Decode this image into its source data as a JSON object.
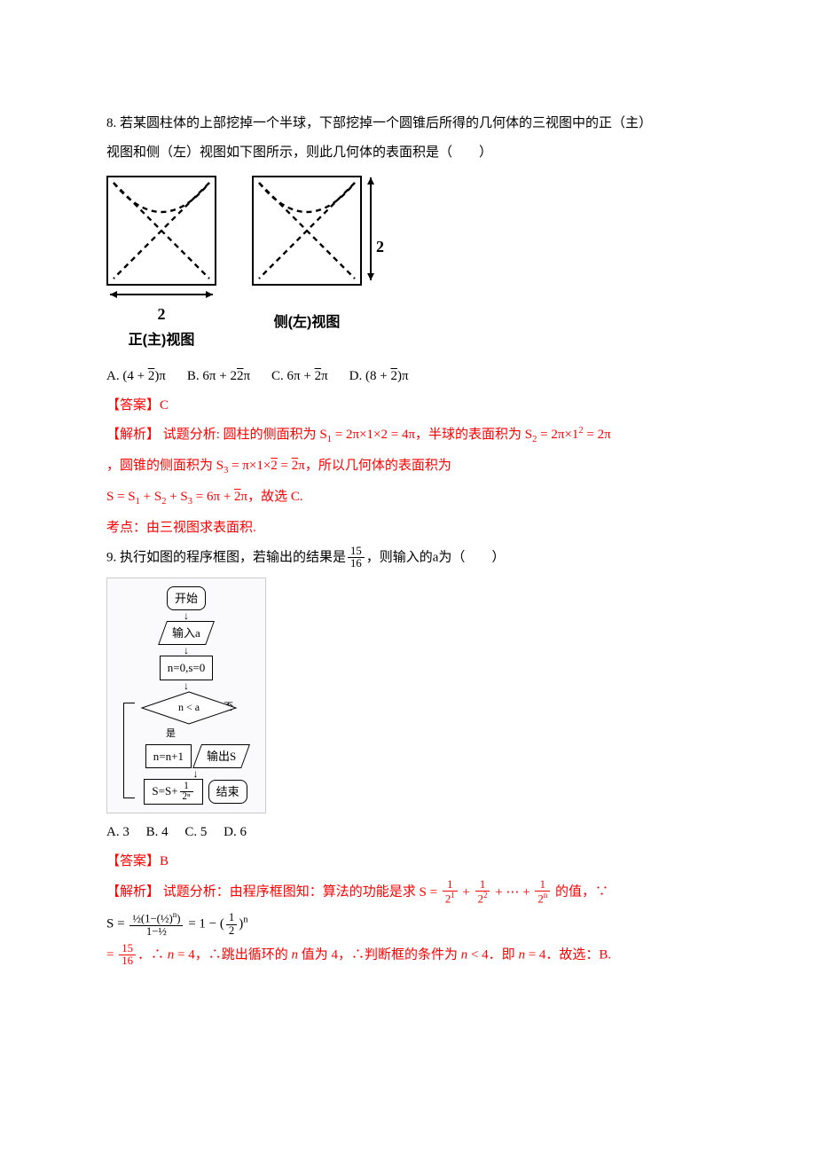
{
  "q8": {
    "number": "8.",
    "text_line1": "若某圆柱体的上部挖掉一个半球，下部挖掉一个圆锥后所得的几何体的三视图中的正（主）",
    "text_line2": "视图和侧（左）视图如下图所示，则此几何体的表面积是（　　）",
    "figure": {
      "front_label": "正(主)视图",
      "side_label": "侧(左)视图",
      "width": "2",
      "height": "2"
    },
    "choices": {
      "A_label": "A.",
      "A": "(4 + √2)π",
      "B_label": "B.",
      "B": "6π + 2√2π",
      "C_label": "C.",
      "C": "6π + √2π",
      "D_label": "D.",
      "D": "(8 + √2)π"
    },
    "answer_label": "【答案】",
    "answer": "C",
    "analysis_label": "【解析】",
    "analysis_1": "试题分析: 圆柱的侧面积为 S₁ = 2π×1×2 = 4π，半球的表面积为 S₂ = 2π×1² = 2π",
    "analysis_2": "，圆锥的侧面积为 S₃ = π×1×√2 = √2π，所以几何体的表面积为",
    "analysis_3": "S = S₁ + S₂ + S₃ = 6π + √2π，故选 C.",
    "topic": "考点：由三视图求表面积."
  },
  "q9": {
    "number": "9.",
    "text": "执行如图的程序框图，若输出的结果是",
    "frac": "15/16",
    "text2": "，则输入的a为（　　）",
    "flowchart": {
      "start": "开始",
      "input": "输入a",
      "init": "n=0,s=0",
      "cond": "n < a",
      "yes": "是",
      "no": "否",
      "step1": "n=n+1",
      "step2_prefix": "S=S+",
      "step2_frac_num": "1",
      "step2_frac_den": "2ⁿ",
      "output": "输出S",
      "end": "结束"
    },
    "choices": {
      "A_label": "A.",
      "A": "3",
      "B_label": "B.",
      "B": "4",
      "C_label": "C.",
      "C": "5",
      "D_label": "D.",
      "D": "6"
    },
    "answer_label": "【答案】",
    "answer": "B",
    "analysis_label": "【解析】",
    "analysis_1a": "试题分析：由程序框图知：算法的功能是求 ",
    "analysis_1_formula": "S = 1/2¹ + 1/2² + ⋯ + 1/2ⁿ",
    "analysis_1b": " 的值，∵",
    "analysis_2": "S = (½(1−(½)ⁿ)) / (1−½) = 1 − (½)ⁿ",
    "analysis_3a": "= 15/16．∴ n = 4，∴跳出循环的 n 值为 4，∴判断框的条件为 n < 4．即 n = 4．故选：B."
  }
}
